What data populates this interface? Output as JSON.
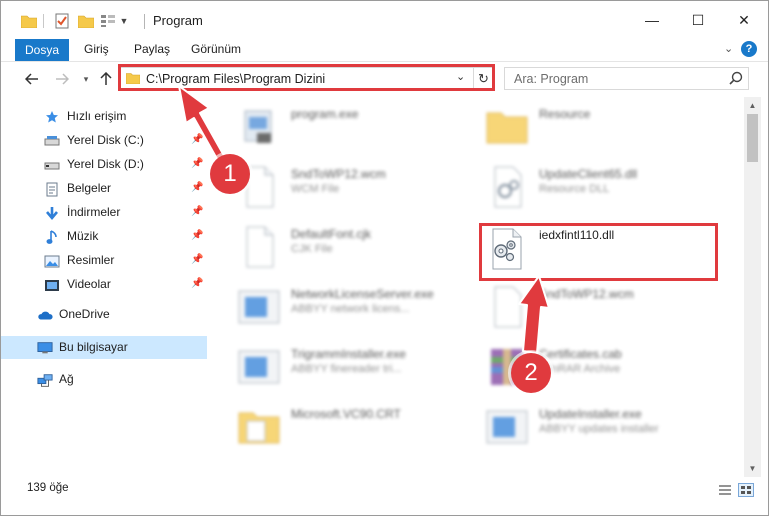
{
  "window": {
    "title": "Program",
    "minimize_glyph": "—",
    "maximize_glyph": "☐",
    "close_glyph": "✕"
  },
  "ribbon": {
    "file_tab": "Dosya",
    "tabs": [
      "Giriş",
      "Paylaş",
      "Görünüm"
    ],
    "help_glyph": "?"
  },
  "address_bar": {
    "path": "C:\\Program Files\\Program Dizini"
  },
  "search": {
    "placeholder": "Ara: Program"
  },
  "sidebar": {
    "items": [
      {
        "label": "Hızlı erişim",
        "icon": "star-icon"
      },
      {
        "label": "Yerel Disk (C:)",
        "icon": "drive-icon",
        "pinned": true
      },
      {
        "label": "Yerel Disk (D:)",
        "icon": "drive-icon",
        "pinned": true
      },
      {
        "label": "Belgeler",
        "icon": "documents-icon",
        "pinned": true
      },
      {
        "label": "İndirmeler",
        "icon": "download-icon",
        "pinned": true
      },
      {
        "label": "Müzik",
        "icon": "music-icon",
        "pinned": true
      },
      {
        "label": "Resimler",
        "icon": "pictures-icon",
        "pinned": true
      },
      {
        "label": "Videolar",
        "icon": "videos-icon",
        "pinned": true
      },
      {
        "label": "OneDrive",
        "icon": "cloud-icon"
      },
      {
        "label": "Bu bilgisayar",
        "icon": "computer-icon",
        "selected": true
      },
      {
        "label": "Ağ",
        "icon": "network-icon"
      }
    ]
  },
  "files": [
    {
      "name": "program.exe",
      "desc": "",
      "icon": "exe-icon",
      "blurred": true
    },
    {
      "name": "Resource",
      "desc": "",
      "icon": "folder-icon",
      "blurred": true
    },
    {
      "name": "SndToWP12.wcm",
      "desc": "WCM File",
      "icon": "blank-file-icon",
      "blurred": true
    },
    {
      "name": "UpdateClient65.dll",
      "desc": "Resource DLL",
      "icon": "dll-icon",
      "blurred": true
    },
    {
      "name": "DefaultFont.cjk",
      "desc": "CJK File",
      "icon": "blank-file-icon",
      "blurred": true
    },
    {
      "name": "iedxfintl110.dll",
      "desc": "",
      "icon": "dll-icon",
      "blurred": false
    },
    {
      "name": "NetworkLicenseServer.exe",
      "desc": "ABBYY network licens...",
      "icon": "app-icon",
      "blurred": true
    },
    {
      "name": "SndToWP12.wcm",
      "desc": "",
      "icon": "blank-file-icon",
      "blurred": true
    },
    {
      "name": "TrigrammInstaller.exe",
      "desc": "ABBYY finereader tri...",
      "icon": "app-icon",
      "blurred": true
    },
    {
      "name": "Certificates.cab",
      "desc": "WinRAR Archive",
      "icon": "archive-icon",
      "blurred": true
    },
    {
      "name": "Microsoft.VC90.CRT",
      "desc": "",
      "icon": "folder-icon",
      "blurred": true
    },
    {
      "name": "UpdateInstaller.exe",
      "desc": "ABBYY updates installer",
      "icon": "app-icon",
      "blurred": true
    }
  ],
  "status_bar": {
    "item_count": "139 öğe"
  },
  "annotations": {
    "badge1": "1",
    "badge2": "2"
  },
  "colors": {
    "accent": "#1979ca",
    "highlight": "#e03a3e",
    "selection": "#cce8ff",
    "folder": "#f5c94a"
  }
}
